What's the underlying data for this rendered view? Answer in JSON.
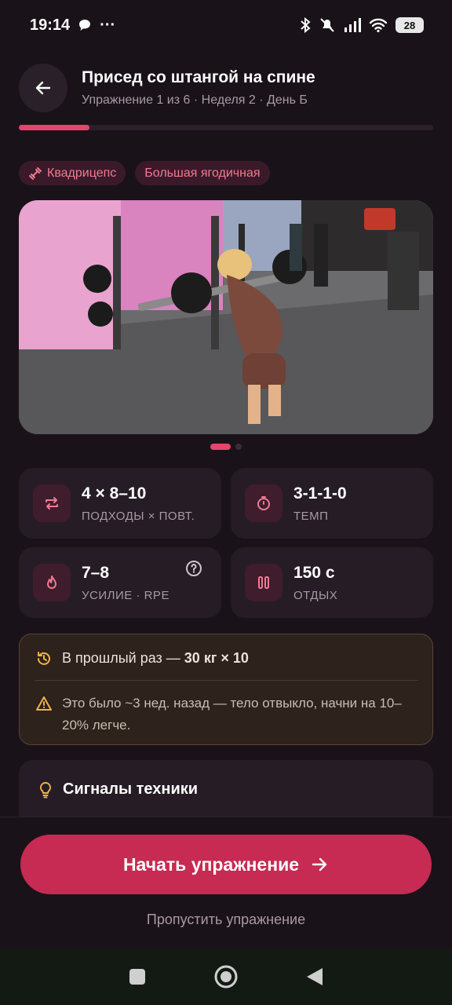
{
  "status_bar": {
    "time": "19:14",
    "dots": "···",
    "battery": "28"
  },
  "header": {
    "title": "Присед со штангой на спине",
    "subtitle": "Упражнение 1 из 6 · Неделя 2 · День Б",
    "progress": 0.17
  },
  "tags": [
    {
      "label": "Квадрицепс",
      "icon": "dumbbell-icon"
    },
    {
      "label": "Большая ягодичная"
    }
  ],
  "carousel": {
    "count": 2,
    "active": 0
  },
  "stats": {
    "sets": {
      "value": "4 × 8–10",
      "label": "ПОДХОДЫ × ПОВТ.",
      "icon": "repeat-icon"
    },
    "tempo": {
      "value": "3-1-1-0",
      "label": "ТЕМП",
      "icon": "stopwatch-icon"
    },
    "effort": {
      "value": "7–8",
      "label": "УСИЛИЕ · RPE",
      "icon": "flame-icon"
    },
    "rest": {
      "value": "150 с",
      "label": "ОТДЫХ",
      "icon": "pause-icon"
    }
  },
  "history": {
    "prefix": "В прошлый раз — ",
    "result": "30 кг × 10",
    "warning": "Это было ~3 нед. назад — тело отвыкло, начни на 10–20% легче."
  },
  "technique": {
    "title": "Сигналы техники"
  },
  "actions": {
    "start_label": "Начать упражнение",
    "skip_label": "Пропустить упражнение"
  },
  "colors": {
    "accent": "#e3456d",
    "button": "#c72a52",
    "background": "#1a1219",
    "card": "#261c25"
  }
}
